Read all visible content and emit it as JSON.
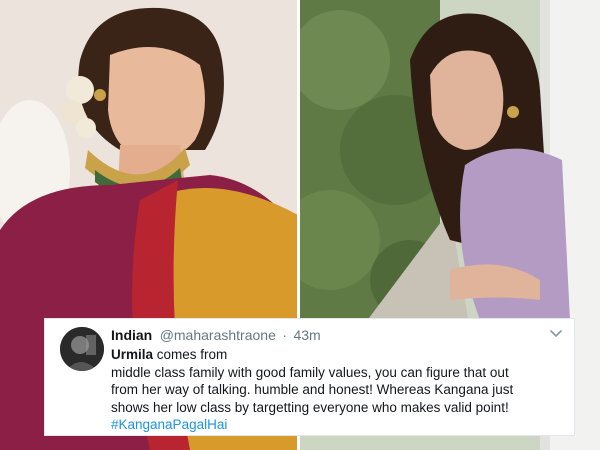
{
  "tweet": {
    "display_name": "Indian",
    "handle": "@maharashtraone",
    "separator": "·",
    "time": "43m",
    "mention_name": "Urmila",
    "line1_rest": " comes from",
    "line2": "middle class family with good family values, you can figure that out",
    "line3": "from her way of talking. humble and honest! Whereas Kangana just",
    "line4": "shows her low class by targetting everyone who makes valid point!",
    "hashtag": "#KanganaPagalHai"
  },
  "icons": {
    "avatar": "profile-photo",
    "menu": "chevron-down-icon"
  },
  "colors": {
    "name": "#14171a",
    "meta": "#657786",
    "hashtag": "#1b95e0",
    "card_border": "#e1e8ed"
  }
}
